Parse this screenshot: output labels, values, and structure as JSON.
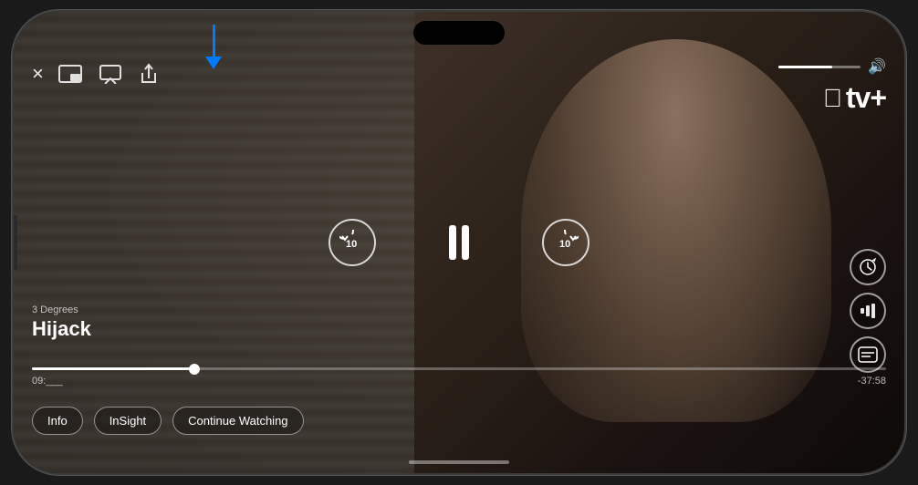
{
  "phone": {
    "brand": "Apple TV+"
  },
  "header": {
    "close_label": "×",
    "volume_level": 65
  },
  "appletv": {
    "symbol": "",
    "text": "tv+"
  },
  "show": {
    "subtitle": "3 Degrees",
    "title": "Hijack"
  },
  "playback": {
    "rewind_label": "10",
    "ff_label": "10",
    "time_current": "09:___",
    "time_remaining": "-37:58",
    "progress_pct": 19
  },
  "bottom_buttons": {
    "info_label": "Info",
    "insight_label": "InSight",
    "continue_label": "Continue Watching"
  },
  "right_actions": {
    "speed_label": "⌚",
    "audio_label": "〜",
    "subtitles_label": "⊟"
  },
  "arrow": {
    "color": "#007AFF"
  }
}
